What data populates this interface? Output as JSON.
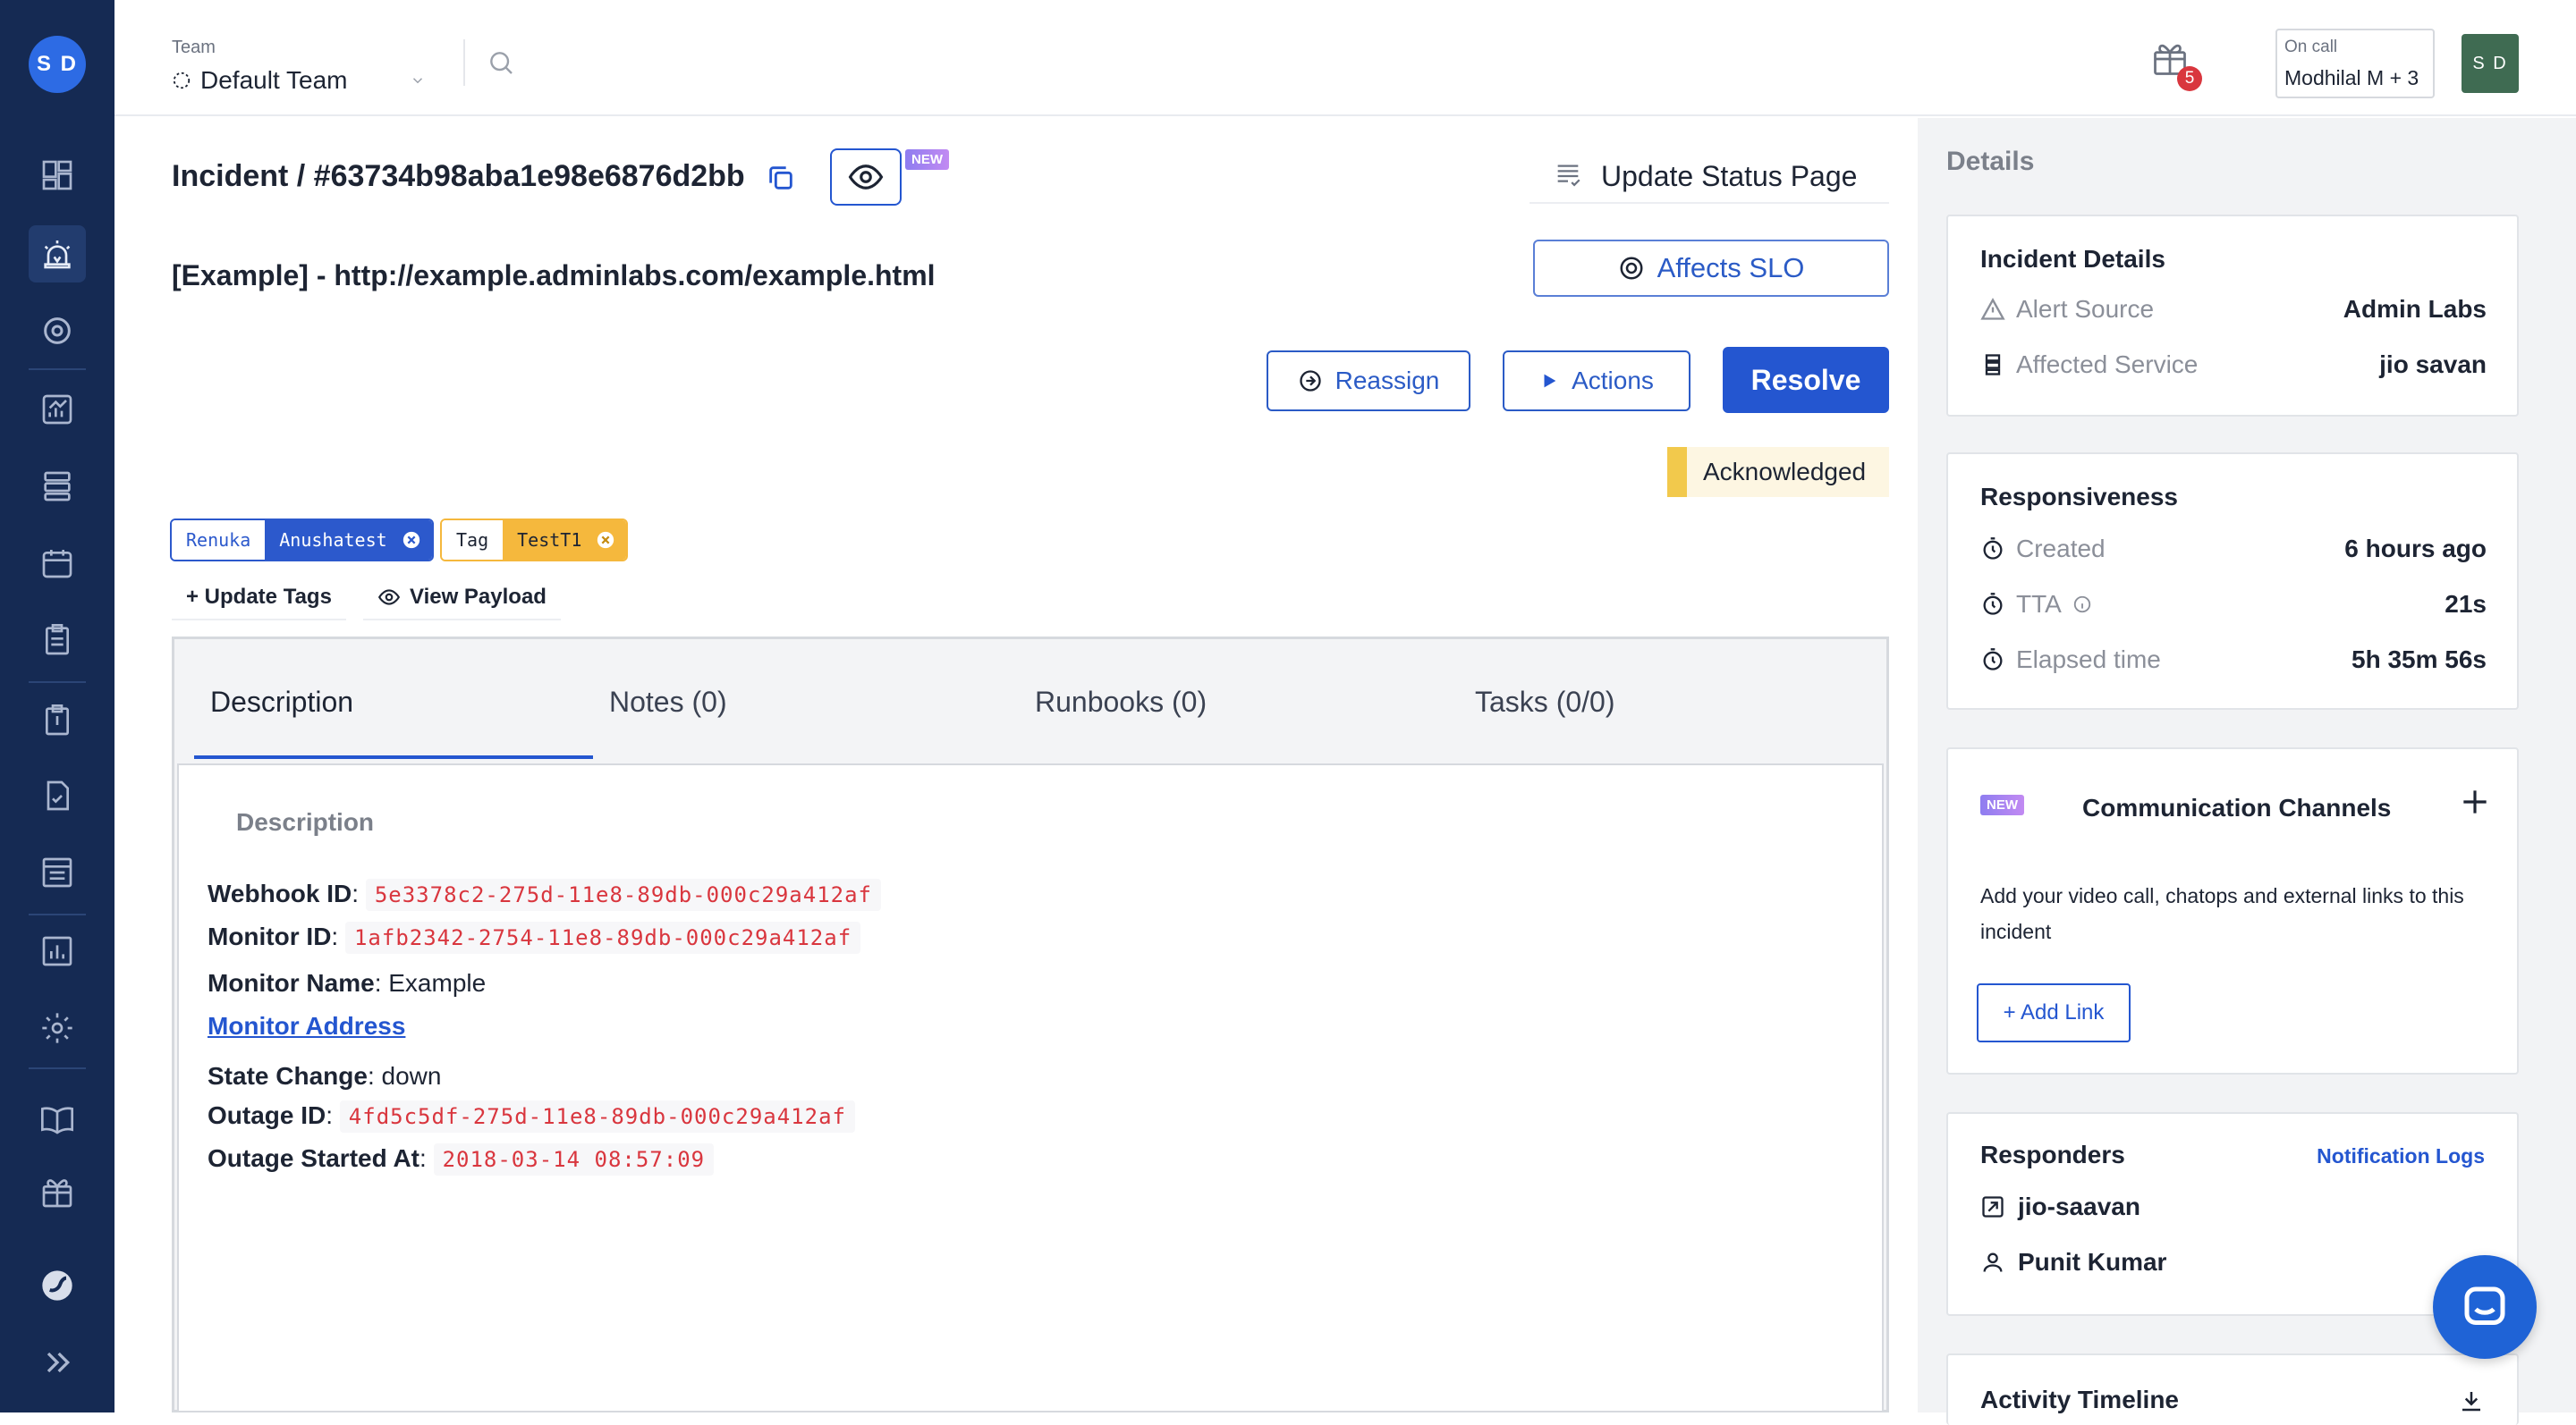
{
  "sidebar": {
    "avatar_initials": "S D",
    "icons": [
      "dashboard-icon",
      "incident-alarm-icon",
      "target-icon",
      "analytics-icon",
      "services-icon",
      "calendar-icon",
      "checklist-icon",
      "runbook-icon",
      "postmortem-icon",
      "status-page-icon",
      "reports-icon",
      "settings-icon",
      "docs-book-icon",
      "gift-box-icon",
      "brand-logo-icon",
      "expand-sidebar-icon"
    ]
  },
  "topbar": {
    "team_label": "Team",
    "team_name": "Default Team",
    "gift_badge_count": "5",
    "oncall_label": "On call",
    "oncall_value": "Modhilal M + 3",
    "user_initials": "S D"
  },
  "incident": {
    "heading": "Incident / #63734b98aba1e98e6876d2bb",
    "watch_badge": "NEW",
    "title": "[Example] - http://example.adminlabs.com/example.html",
    "update_status_page_label": "Update Status Page",
    "affects_slo_label": "Affects SLO",
    "reassign_label": "Reassign",
    "actions_label": "Actions",
    "resolve_label": "Resolve",
    "status_label": "Acknowledged",
    "tags": [
      {
        "key": "Renuka",
        "value": "Anushatest"
      },
      {
        "key": "Tag",
        "value": "TestT1"
      }
    ],
    "update_tags_label": "+ Update Tags",
    "view_payload_label": "View Payload"
  },
  "tabs": [
    "Description",
    "Notes (0)",
    "Runbooks (0)",
    "Tasks (0/0)"
  ],
  "description": {
    "heading": "Description",
    "webhook_id_label": "Webhook ID",
    "webhook_id": "5e3378c2-275d-11e8-89db-000c29a412af",
    "monitor_id_label": "Monitor ID",
    "monitor_id": "1afb2342-2754-11e8-89db-000c29a412af",
    "monitor_name_label": "Monitor Name",
    "monitor_name": "Example",
    "monitor_address_link": "Monitor Address",
    "state_change_label": "State Change",
    "state_change": "down",
    "outage_id_label": "Outage ID",
    "outage_id": "4fd5c5df-275d-11e8-89db-000c29a412af",
    "outage_started_label": "Outage Started At",
    "outage_started": "2018-03-14 08:57:09"
  },
  "details": {
    "heading": "Details",
    "incident_details": {
      "title": "Incident Details",
      "alert_source_label": "Alert Source",
      "alert_source": "Admin Labs",
      "affected_service_label": "Affected Service",
      "affected_service": "jio savan"
    },
    "responsiveness": {
      "title": "Responsiveness",
      "created_label": "Created",
      "created": "6 hours ago",
      "tta_label": "TTA",
      "tta": "21s",
      "elapsed_label": "Elapsed time",
      "elapsed": "5h 35m 56s"
    },
    "channels": {
      "badge": "NEW",
      "title": "Communication Channels",
      "description": "Add your video call, chatops and external links to this incident",
      "add_link_label": "+ Add Link"
    },
    "responders": {
      "title": "Responders",
      "notification_logs_label": "Notification Logs",
      "items": [
        "jio-saavan",
        "Punit Kumar"
      ]
    },
    "activity_timeline_title": "Activity Timeline"
  },
  "colors": {
    "sidebar_bg": "#152a53",
    "primary": "#2456d0",
    "acknowledged": "#f2c94c",
    "tag_blue": "#2c59cc",
    "tag_yellow": "#f5b83d"
  }
}
